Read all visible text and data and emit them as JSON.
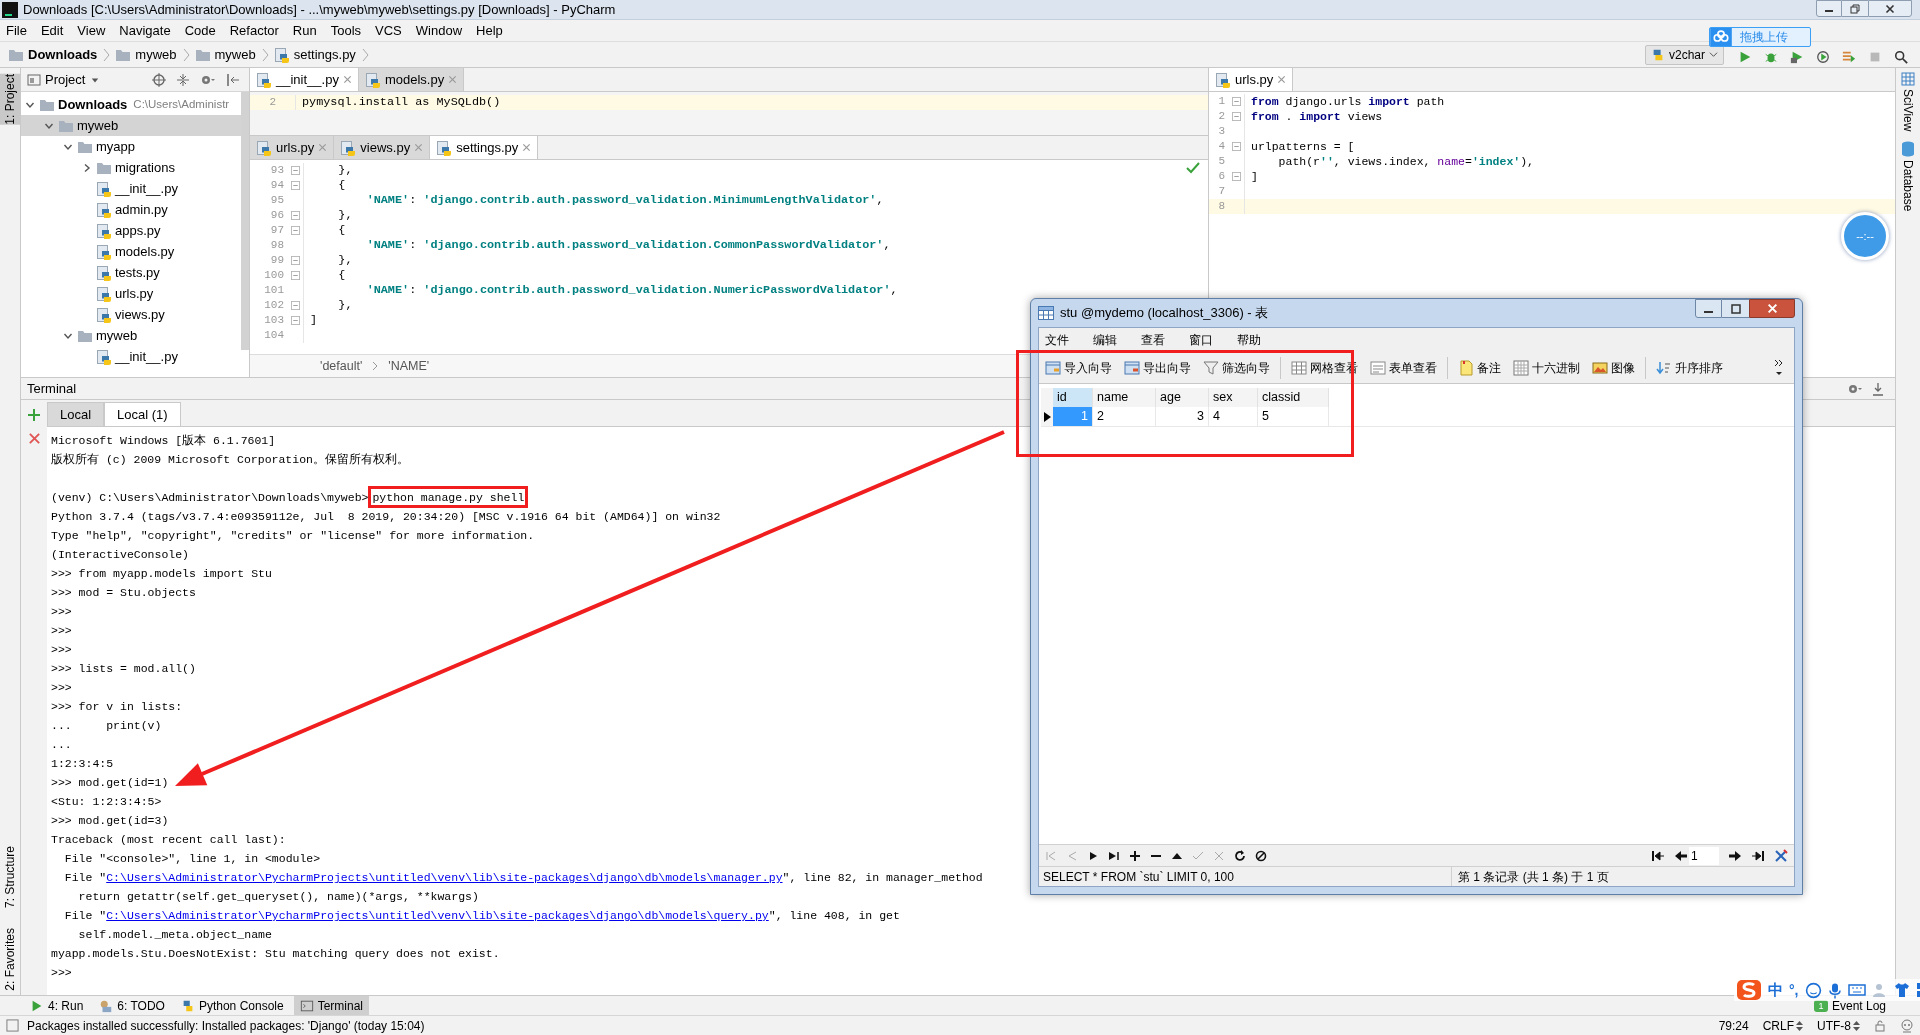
{
  "window": {
    "title": "Downloads [C:\\Users\\Administrator\\Downloads] - ...\\myweb\\myweb\\settings.py [Downloads] - PyCharm"
  },
  "menu": [
    "File",
    "Edit",
    "View",
    "Navigate",
    "Code",
    "Refactor",
    "Run",
    "Tools",
    "VCS",
    "Window",
    "Help"
  ],
  "breadcrumb": [
    {
      "label": "Downloads",
      "kind": "folder"
    },
    {
      "label": "myweb",
      "kind": "folder"
    },
    {
      "label": "myweb",
      "kind": "folder"
    },
    {
      "label": "settings.py",
      "kind": "file"
    }
  ],
  "run_config": "v2char",
  "upload_button": "拖拽上传",
  "float_clock": "--:--",
  "left_strip": [
    {
      "label": "1: Project",
      "selected": true
    },
    {
      "label": "7: Structure",
      "selected": false
    },
    {
      "label": "2: Favorites",
      "selected": false
    }
  ],
  "right_strip": [
    "SciView",
    "Database"
  ],
  "project": {
    "title": "Project",
    "tree": [
      {
        "label": "Downloads",
        "path": "C:\\Users\\Administr",
        "kind": "folder",
        "expanded": true,
        "selected": false,
        "children": [
          {
            "label": "myweb",
            "kind": "folder",
            "expanded": true,
            "selected": true,
            "children": [
              {
                "label": "myapp",
                "kind": "folder",
                "expanded": true,
                "selected": false,
                "children": [
                  {
                    "label": "migrations",
                    "kind": "folder",
                    "expanded": false,
                    "selected": false
                  },
                  {
                    "label": "__init__.py",
                    "kind": "file",
                    "selected": false
                  },
                  {
                    "label": "admin.py",
                    "kind": "file",
                    "selected": false
                  },
                  {
                    "label": "apps.py",
                    "kind": "file",
                    "selected": false
                  },
                  {
                    "label": "models.py",
                    "kind": "file",
                    "selected": false
                  },
                  {
                    "label": "tests.py",
                    "kind": "file",
                    "selected": false
                  },
                  {
                    "label": "urls.py",
                    "kind": "file",
                    "selected": false
                  },
                  {
                    "label": "views.py",
                    "kind": "file",
                    "selected": false
                  }
                ]
              },
              {
                "label": "myweb",
                "kind": "folder",
                "expanded": true,
                "selected": false,
                "children": [
                  {
                    "label": "__init__.py",
                    "kind": "file",
                    "selected": false
                  }
                ]
              }
            ]
          }
        ]
      }
    ]
  },
  "editor_left": {
    "groups": [
      {
        "tabs": [
          {
            "label": "__init__.py",
            "selected": true
          },
          {
            "label": "models.py",
            "selected": false
          }
        ],
        "lines": [
          {
            "number": "2",
            "current": true,
            "fold": false,
            "segments": [
              {
                "kind": "plain",
                "text": "pymysql.install as MySQLdb()"
              }
            ]
          }
        ]
      },
      {
        "tabs": [
          {
            "label": "urls.py",
            "selected": false
          },
          {
            "label": "views.py",
            "selected": false
          },
          {
            "label": "settings.py",
            "selected": true
          }
        ],
        "lines": [
          {
            "number": "93",
            "current": false,
            "fold": true,
            "segments": [
              {
                "kind": "plain",
                "text": "    },"
              }
            ]
          },
          {
            "number": "94",
            "current": false,
            "fold": true,
            "segments": [
              {
                "kind": "plain",
                "text": "    {"
              }
            ]
          },
          {
            "number": "95",
            "current": false,
            "fold": false,
            "segments": [
              {
                "kind": "str",
                "text": "        'NAME'"
              },
              {
                "kind": "plain",
                "text": ": "
              },
              {
                "kind": "str",
                "text": "'django.contrib.auth.password_validation.MinimumLengthValidator'"
              },
              {
                "kind": "plain",
                "text": ","
              }
            ]
          },
          {
            "number": "96",
            "current": false,
            "fold": true,
            "segments": [
              {
                "kind": "plain",
                "text": "    },"
              }
            ]
          },
          {
            "number": "97",
            "current": false,
            "fold": true,
            "segments": [
              {
                "kind": "plain",
                "text": "    {"
              }
            ]
          },
          {
            "number": "98",
            "current": false,
            "fold": false,
            "segments": [
              {
                "kind": "str",
                "text": "        'NAME'"
              },
              {
                "kind": "plain",
                "text": ": "
              },
              {
                "kind": "str",
                "text": "'django.contrib.auth.password_validation.CommonPasswordValidator'"
              },
              {
                "kind": "plain",
                "text": ","
              }
            ]
          },
          {
            "number": "99",
            "current": false,
            "fold": true,
            "segments": [
              {
                "kind": "plain",
                "text": "    },"
              }
            ]
          },
          {
            "number": "100",
            "current": false,
            "fold": true,
            "segments": [
              {
                "kind": "plain",
                "text": "    {"
              }
            ]
          },
          {
            "number": "101",
            "current": false,
            "fold": false,
            "segments": [
              {
                "kind": "str",
                "text": "        'NAME'"
              },
              {
                "kind": "plain",
                "text": ": "
              },
              {
                "kind": "str",
                "text": "'django.contrib.auth.password_validation.NumericPasswordValidator'"
              },
              {
                "kind": "plain",
                "text": ","
              }
            ]
          },
          {
            "number": "102",
            "current": false,
            "fold": true,
            "segments": [
              {
                "kind": "plain",
                "text": "    },"
              }
            ]
          },
          {
            "number": "103",
            "current": false,
            "fold": true,
            "segments": [
              {
                "kind": "plain",
                "text": "]"
              }
            ]
          },
          {
            "number": "104",
            "current": false,
            "fold": false
          }
        ],
        "crumbs": [
          "'default'",
          "'NAME'"
        ]
      }
    ]
  },
  "editor_right": {
    "tabs": [
      {
        "label": "urls.py",
        "selected": true
      }
    ],
    "lines": [
      {
        "number": "1",
        "current": false,
        "fold": true,
        "segments": [
          {
            "kind": "kw",
            "text": "from"
          },
          {
            "kind": "plain",
            "text": " django.urls "
          },
          {
            "kind": "kw",
            "text": "import"
          },
          {
            "kind": "plain",
            "text": " path"
          }
        ]
      },
      {
        "number": "2",
        "current": false,
        "fold": true,
        "segments": [
          {
            "kind": "kw",
            "text": "from"
          },
          {
            "kind": "plain",
            "text": " . "
          },
          {
            "kind": "kw",
            "text": "import"
          },
          {
            "kind": "plain",
            "text": " views"
          }
        ]
      },
      {
        "number": "3",
        "current": false,
        "fold": false
      },
      {
        "number": "4",
        "current": false,
        "fold": true,
        "segments": [
          {
            "kind": "plain",
            "text": "urlpatterns = ["
          }
        ]
      },
      {
        "number": "5",
        "current": false,
        "fold": false,
        "segments": [
          {
            "kind": "plain",
            "text": "    path(r"
          },
          {
            "kind": "str",
            "text": "''"
          },
          {
            "kind": "plain",
            "text": ", views.index, "
          },
          {
            "kind": "param",
            "text": "name"
          },
          {
            "kind": "plain",
            "text": "="
          },
          {
            "kind": "str",
            "text": "'index'"
          },
          {
            "kind": "plain",
            "text": "),"
          }
        ]
      },
      {
        "number": "6",
        "current": false,
        "fold": true,
        "segments": [
          {
            "kind": "plain",
            "text": "]"
          }
        ]
      },
      {
        "number": "7",
        "current": false,
        "fold": false
      },
      {
        "number": "8",
        "current": true,
        "fold": false
      }
    ]
  },
  "terminal": {
    "title": "Terminal",
    "tabs": [
      {
        "label": "Local",
        "selected": false
      },
      {
        "label": "Local (1)",
        "selected": true
      }
    ],
    "lines": [
      {
        "kind": "text",
        "text": "Microsoft Windows [版本 6.1.7601]"
      },
      {
        "kind": "text",
        "text": "版权所有 (c) 2009 Microsoft Corporation。保留所有权利。"
      },
      {
        "kind": "blank"
      },
      {
        "kind": "segments",
        "segments": [
          {
            "kind": "plain",
            "text": "(venv) C:\\Users\\Administrator\\Downloads\\myweb>"
          },
          {
            "kind": "boxed",
            "text": "python manage.py shell"
          }
        ]
      },
      {
        "kind": "text",
        "text": "Python 3.7.4 (tags/v3.7.4:e09359112e, Jul  8 2019, 20:34:20) [MSC v.1916 64 bit (AMD64)] on win32"
      },
      {
        "kind": "text",
        "text": "Type \"help\", \"copyright\", \"credits\" or \"license\" for more information."
      },
      {
        "kind": "text",
        "text": "(InteractiveConsole)"
      },
      {
        "kind": "text",
        "text": ">>> from myapp.models import Stu"
      },
      {
        "kind": "text",
        "text": ">>> mod = Stu.objects"
      },
      {
        "kind": "text",
        "text": ">>>"
      },
      {
        "kind": "text",
        "text": ">>>"
      },
      {
        "kind": "text",
        "text": ">>>"
      },
      {
        "kind": "text",
        "text": ">>> lists = mod.all()"
      },
      {
        "kind": "text",
        "text": ">>>"
      },
      {
        "kind": "text",
        "text": ">>> for v in lists:"
      },
      {
        "kind": "text",
        "text": "...     print(v)"
      },
      {
        "kind": "text",
        "text": "..."
      },
      {
        "kind": "text",
        "text": "1:2:3:4:5"
      },
      {
        "kind": "text",
        "text": ">>> mod.get(id=1)"
      },
      {
        "kind": "text",
        "text": "<Stu: 1:2:3:4:5>"
      },
      {
        "kind": "text",
        "text": ">>> mod.get(id=3)"
      },
      {
        "kind": "text",
        "text": "Traceback (most recent call last):"
      },
      {
        "kind": "text",
        "text": "  File \"<console>\", line 1, in <module>"
      },
      {
        "kind": "segments",
        "segments": [
          {
            "kind": "plain",
            "text": "  File \""
          },
          {
            "kind": "link",
            "text": "C:\\Users\\Administrator\\PycharmProjects\\untitled\\venv\\lib\\site-packages\\django\\db\\models\\manager.py"
          },
          {
            "kind": "plain",
            "text": "\", line 82, in manager_method"
          }
        ]
      },
      {
        "kind": "text",
        "text": "    return getattr(self.get_queryset(), name)(*args, **kwargs)"
      },
      {
        "kind": "segments",
        "segments": [
          {
            "kind": "plain",
            "text": "  File \""
          },
          {
            "kind": "link",
            "text": "C:\\Users\\Administrator\\PycharmProjects\\untitled\\venv\\lib\\site-packages\\django\\db\\models\\query.py"
          },
          {
            "kind": "plain",
            "text": "\", line 408, in get"
          }
        ]
      },
      {
        "kind": "text",
        "text": "    self.model._meta.object_name"
      },
      {
        "kind": "text",
        "text": "myapp.models.Stu.DoesNotExist: Stu matching query does not exist."
      },
      {
        "kind": "text",
        "text": ">>>"
      }
    ]
  },
  "tool_windows": [
    {
      "label": "4: Run",
      "selected": false
    },
    {
      "label": "6: TODO",
      "selected": false
    },
    {
      "label": "Python Console",
      "selected": false
    },
    {
      "label": "Terminal",
      "selected": true
    }
  ],
  "event_log": {
    "label": "Event Log",
    "count": "1"
  },
  "ime": {
    "mode": "中",
    "punct": "°,"
  },
  "status_bar": {
    "message": "Packages installed successfully: Installed packages: 'Django' (today 15:04)",
    "items": [
      "79:24",
      "CRLF",
      "UTF-8"
    ]
  },
  "navicat": {
    "title": "stu @mydemo (localhost_3306) - 表",
    "menu": [
      "文件",
      "编辑",
      "查看",
      "窗口",
      "帮助"
    ],
    "toolbar": [
      "导入向导",
      "导出向导",
      "筛选向导",
      "网格查看",
      "表单查看",
      "备注",
      "十六进制",
      "图像",
      "升序排序"
    ],
    "columns": [
      {
        "label": "id",
        "numeric": true
      },
      {
        "label": "name",
        "numeric": false
      },
      {
        "label": "age",
        "numeric": true
      },
      {
        "label": "sex",
        "numeric": false
      },
      {
        "label": "classid",
        "numeric": false
      }
    ],
    "rows": [
      {
        "selected": true,
        "cells": [
          "1",
          "2",
          "3",
          "4",
          "5"
        ]
      }
    ],
    "page": "1",
    "sql": "SELECT * FROM `stu` LIMIT 0, 100",
    "record_info": "第 1 条记录 (共 1 条) 于 1 页"
  }
}
